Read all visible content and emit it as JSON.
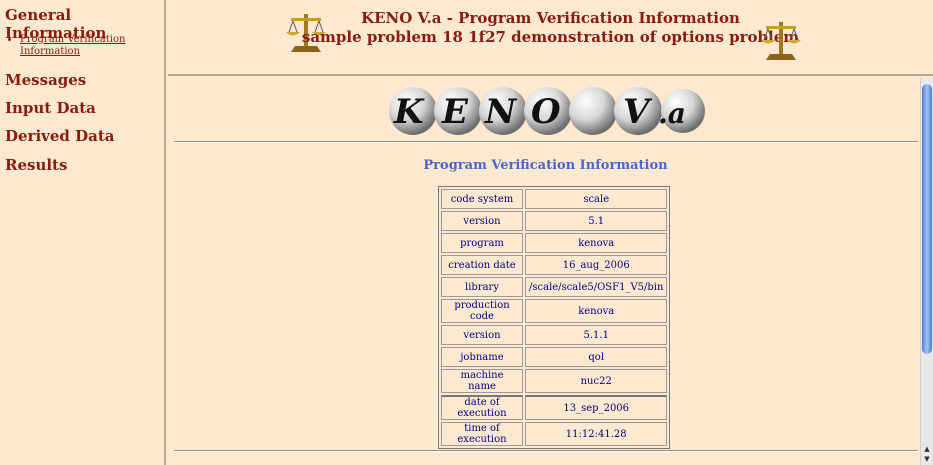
{
  "nav": {
    "general": "General Information",
    "sub_items": [
      "Program Verification Information"
    ],
    "messages": "Messages",
    "input": "Input Data",
    "derived": "Derived Data",
    "results": "Results"
  },
  "header": {
    "line1": "KENO V.a - Program Verification Information",
    "line2": "sample problem 18 1f27 demonstration of options problem"
  },
  "logo_text": "KENO V.a",
  "section_title": "Program Verification Information",
  "table": [
    {
      "label": "code system",
      "value": "scale"
    },
    {
      "label": "version",
      "value": "5.1"
    },
    {
      "label": "program",
      "value": "kenova"
    },
    {
      "label": "creation date",
      "value": "16_aug_2006"
    },
    {
      "label": "library",
      "value": "/scale/scale5/OSF1_V5/bin"
    },
    {
      "label": "production code",
      "value": "kenova"
    },
    {
      "label": "version",
      "value": "5.1.1"
    },
    {
      "label": "jobname",
      "value": "qol"
    },
    {
      "label": "machine name",
      "value": "nuc22"
    },
    {
      "label": "date of execution",
      "value": "13_sep_2006"
    },
    {
      "label": "time of execution",
      "value": "11:12:41.28"
    }
  ],
  "icons": {
    "scale": "balance-scale-icon",
    "ball": "sphere-icon"
  },
  "colors": {
    "heading": "#8b1a10",
    "section": "#4a66d0",
    "cell_text": "#000080",
    "background": "#fde9cf"
  }
}
